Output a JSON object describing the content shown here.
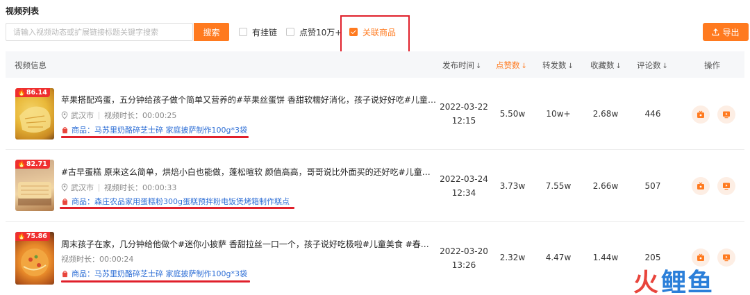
{
  "page": {
    "title": "视频列表"
  },
  "search": {
    "placeholder": "请输入视频动态或扩展链接标题关键字搜索",
    "value": "",
    "button_label": "搜索"
  },
  "filters": [
    {
      "label": "有挂链",
      "checked": false
    },
    {
      "label": "点赞10万+",
      "checked": false
    },
    {
      "label": "关联商品",
      "checked": true
    }
  ],
  "export": {
    "label": "导出"
  },
  "table": {
    "columns": {
      "info": "视频信息",
      "publish": "发布时间",
      "likes": "点赞数",
      "reposts": "转发数",
      "collects": "收藏数",
      "comments": "评论数",
      "actions": "操作"
    },
    "rows": [
      {
        "heat": "86.14",
        "title": "苹果搭配鸡蛋，五分钟给孩子做个简单又营养的#苹果丝蛋饼 香甜软糯好消化，孩子说好好吃#儿童美...",
        "location": "武汉市",
        "duration_label": "视频时长：00:00:25",
        "product": "商品：马苏里奶酪碎芝士碎 家庭披萨制作100g*3袋",
        "date": "2022-03-22",
        "time": "12:15",
        "likes": "5.50w",
        "reposts": "10w+",
        "collects": "2.68w",
        "comments": "446"
      },
      {
        "heat": "82.71",
        "title": "#古早蛋糕 原来这么简单，烘焙小白也能做，蓬松暄软 颜值高高，哥哥说比外面买的还好吃#儿童美...",
        "location": "武汉市",
        "duration_label": "视频时长：00:00:33",
        "product": "商品：森庄农品家用蛋糕粉300g蛋糕预拌粉电饭煲烤箱制作糕点",
        "date": "2022-03-24",
        "time": "12:34",
        "likes": "3.73w",
        "reposts": "7.55w",
        "collects": "2.66w",
        "comments": "507"
      },
      {
        "heat": "75.86",
        "title": "周末孩子在家，几分钟给他做个#迷你小披萨 香甜拉丝一口一个，孩子说好吃极啦#儿童美食 #春日胖...",
        "location": "",
        "duration_label": "视频时长：00:00:24",
        "product": "商品：马苏里奶酪碎芝士碎 家庭披萨制作100g*3袋",
        "date": "2022-03-20",
        "time": "13:26",
        "likes": "2.32w",
        "reposts": "4.47w",
        "collects": "1.44w",
        "comments": "205"
      }
    ]
  },
  "watermark": {
    "part1": "火",
    "part2": "鲤鱼"
  },
  "colors": {
    "accent": "#ff7a1f",
    "highlight": "#e0202b",
    "link": "#2f6fd6",
    "badge": "#ef2f2f"
  }
}
